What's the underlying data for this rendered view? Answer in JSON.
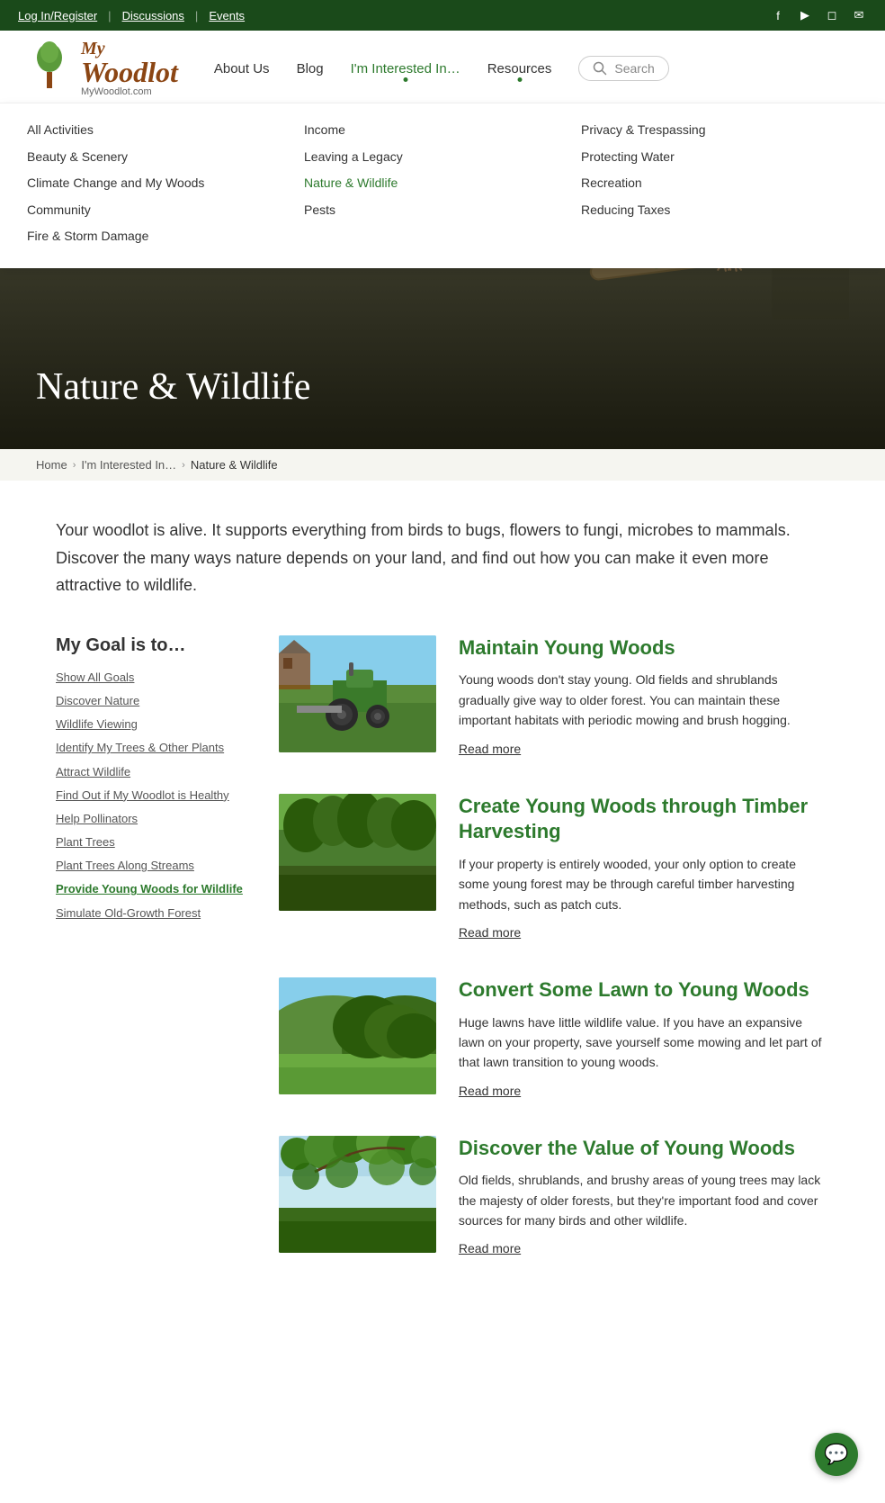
{
  "topbar": {
    "login": "Log In/Register",
    "discussions": "Discussions",
    "events": "Events",
    "socials": [
      "facebook",
      "youtube",
      "instagram",
      "email"
    ]
  },
  "header": {
    "logo": {
      "my": "My",
      "woodlot": "Woodlot",
      "sub": "MyWoodlot.com"
    },
    "nav": [
      {
        "label": "About Us",
        "active": false
      },
      {
        "label": "Blog",
        "active": false
      },
      {
        "label": "I'm Interested In…",
        "active": true
      },
      {
        "label": "Resources",
        "active": false
      }
    ],
    "search_placeholder": "Search"
  },
  "dropdown": {
    "col1": [
      {
        "label": "All Activities",
        "highlighted": false
      },
      {
        "label": "Beauty & Scenery",
        "highlighted": false
      },
      {
        "label": "Climate Change and My Woods",
        "highlighted": false
      },
      {
        "label": "Community",
        "highlighted": false
      },
      {
        "label": "Fire & Storm Damage",
        "highlighted": false
      }
    ],
    "col2": [
      {
        "label": "Income",
        "highlighted": false
      },
      {
        "label": "Leaving a Legacy",
        "highlighted": false
      },
      {
        "label": "Nature & Wildlife",
        "highlighted": true
      },
      {
        "label": "Pests",
        "highlighted": false
      }
    ],
    "col3": [
      {
        "label": "Privacy & Trespassing",
        "highlighted": false
      },
      {
        "label": "Protecting Water",
        "highlighted": false
      },
      {
        "label": "Recreation",
        "highlighted": false
      },
      {
        "label": "Reducing Taxes",
        "highlighted": false
      }
    ]
  },
  "hero": {
    "title": "Nature & Wildlife"
  },
  "breadcrumb": {
    "home": "Home",
    "parent": "I'm Interested In…",
    "current": "Nature & Wildlife"
  },
  "intro": {
    "text": "Your woodlot is alive. It supports everything from birds to bugs, flowers to fungi, microbes to mammals. Discover the many ways nature depends on your land, and find out how you can make it even more attractive to wildlife."
  },
  "sidebar": {
    "title": "My Goal is to…",
    "links": [
      {
        "label": "Show All Goals",
        "active": false
      },
      {
        "label": "Discover Nature",
        "active": false
      },
      {
        "label": "Wildlife Viewing",
        "active": false
      },
      {
        "label": "Identify My Trees & Other Plants",
        "active": false
      },
      {
        "label": "Attract Wildlife",
        "active": false
      },
      {
        "label": "Find Out if My Woodlot is Healthy",
        "active": false
      },
      {
        "label": "Help Pollinators",
        "active": false
      },
      {
        "label": "Plant Trees",
        "active": false
      },
      {
        "label": "Plant Trees Along Streams",
        "active": false
      },
      {
        "label": "Provide Young Woods for Wildlife",
        "active": true
      },
      {
        "label": "Simulate Old-Growth Forest",
        "active": false
      }
    ]
  },
  "articles": [
    {
      "title": "Maintain Young Woods",
      "description": "Young woods don't stay young. Old fields and shrublands gradually give way to older forest. You can maintain these important habitats with periodic mowing and brush hogging.",
      "read_more": "Read more",
      "img_class": "img-tractor"
    },
    {
      "title": "Create Young Woods through Timber Harvesting",
      "description": "If your property is entirely wooded, your only option to create some young forest may be through careful timber harvesting methods, such as patch cuts.",
      "read_more": "Read more",
      "img_class": "img-woods"
    },
    {
      "title": "Convert Some Lawn to Young Woods",
      "description": "Huge lawns have little wildlife value. If you have an expansive lawn on your property, save yourself some mowing and let part of that lawn transition to young woods.",
      "read_more": "Read more",
      "img_class": "img-lawn"
    },
    {
      "title": "Discover the Value of Young Woods",
      "description": "Old fields, shrublands, and brushy areas of young trees may lack the majesty of older forests, but they're important food and cover sources for many birds and other wildlife.",
      "read_more": "Read more",
      "img_class": "img-youngwoods"
    }
  ],
  "chat": {
    "icon": "💬"
  }
}
